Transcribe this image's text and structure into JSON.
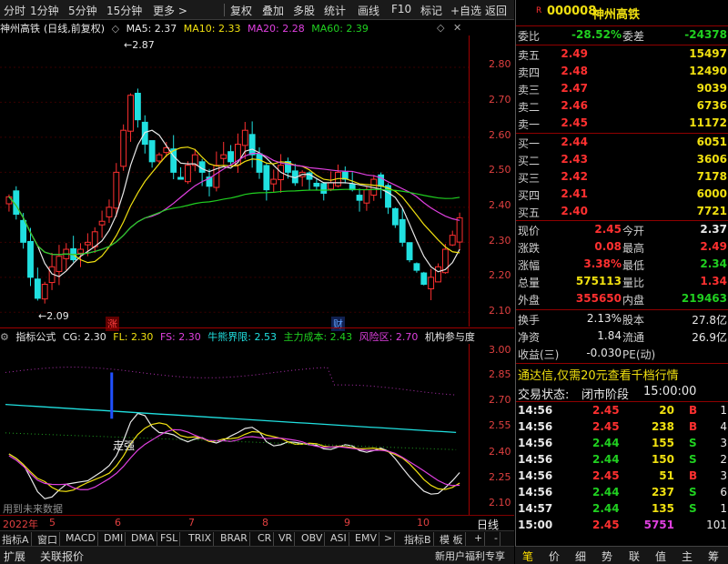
{
  "toolbar": {
    "items": [
      "分时",
      "1分钟",
      "5分钟",
      "15分钟",
      "更多 >",
      "复权",
      "叠加",
      "多股",
      "统计",
      "画线",
      "F10",
      "标记",
      "+自选",
      "返回"
    ]
  },
  "kline": {
    "name": "神州高铁",
    "mode": "(日线,前复权)",
    "ma": [
      {
        "label": "MA5: 2.37",
        "color": "#e8e8e8"
      },
      {
        "label": "MA10: 2.33",
        "color": "#f0e010"
      },
      {
        "label": "MA20: 2.28",
        "color": "#e040e0"
      },
      {
        "label": "MA60: 2.39",
        "color": "#20d020"
      }
    ],
    "y_ticks": [
      "2.80",
      "2.70",
      "2.60",
      "2.50",
      "2.40",
      "2.30",
      "2.20",
      "2.10"
    ],
    "high_mark": "2.87",
    "low_mark": "2.09",
    "tag_zhang": "涨",
    "tag_cai": "财",
    "closes": [
      2.43,
      2.38,
      2.3,
      2.2,
      2.14,
      2.18,
      2.23,
      2.26,
      2.28,
      2.25,
      2.28,
      2.3,
      2.33,
      2.36,
      2.4,
      2.5,
      2.62,
      2.72,
      2.65,
      2.58,
      2.53,
      2.55,
      2.57,
      2.5,
      2.48,
      2.52,
      2.55,
      2.5,
      2.46,
      2.52,
      2.55,
      2.53,
      2.58,
      2.62,
      2.55,
      2.5,
      2.45,
      2.48,
      2.52,
      2.5,
      2.47,
      2.5,
      2.48,
      2.46,
      2.44,
      2.47,
      2.5,
      2.48,
      2.45,
      2.42,
      2.45,
      2.48,
      2.46,
      2.4,
      2.35,
      2.3,
      2.25,
      2.22,
      2.18,
      2.2,
      2.23,
      2.28,
      2.32,
      2.37
    ]
  },
  "indicator": {
    "name": "指标公式",
    "items": [
      {
        "label": "CG: 2.30",
        "color": "#e8e8e8"
      },
      {
        "label": "FL: 2.30",
        "color": "#f0e010"
      },
      {
        "label": "FS: 2.30",
        "color": "#e040e0"
      },
      {
        "label": "牛熊界限: 2.53",
        "color": "#20e0e0"
      },
      {
        "label": "主力成本: 2.43",
        "color": "#20d020"
      },
      {
        "label": "风险区: 2.70",
        "color": "#e040e0"
      },
      {
        "label": "机构参与度",
        "color": "#e8e8e8"
      }
    ],
    "y_ticks": [
      "3.00",
      "2.85",
      "2.70",
      "2.55",
      "2.40",
      "2.25",
      "2.10"
    ],
    "label_zouqiang": "走强",
    "footer": "用到未来数据"
  },
  "dates": {
    "items": [
      "2022年",
      "5",
      "6",
      "7",
      "8",
      "9",
      "10"
    ],
    "period": "日线"
  },
  "tabs": [
    "指标A",
    "窗口",
    "MACD",
    "DMI",
    "DMA",
    "FSL",
    "TRIX",
    "BRAR",
    "CR",
    "VR",
    "OBV",
    "ASI",
    "EMV",
    ">",
    "指标B",
    "模 板",
    "+",
    "-"
  ],
  "bottom": [
    "扩展",
    "关联报价",
    "新用户福利专享"
  ],
  "quote": {
    "code": "000008",
    "name": "神州高铁",
    "flag": "R",
    "wb_label": "委比",
    "wb_value": "-28.52%",
    "wc_label": "委差",
    "wc_value": "-24378",
    "asks": [
      {
        "label": "卖五",
        "price": "2.49",
        "vol": "15497"
      },
      {
        "label": "卖四",
        "price": "2.48",
        "vol": "12490"
      },
      {
        "label": "卖三",
        "price": "2.47",
        "vol": "9039"
      },
      {
        "label": "卖二",
        "price": "2.46",
        "vol": "6736"
      },
      {
        "label": "卖一",
        "price": "2.45",
        "vol": "11172"
      }
    ],
    "bids": [
      {
        "label": "买一",
        "price": "2.44",
        "vol": "6051"
      },
      {
        "label": "买二",
        "price": "2.43",
        "vol": "3606"
      },
      {
        "label": "买三",
        "price": "2.42",
        "vol": "7178"
      },
      {
        "label": "买四",
        "price": "2.41",
        "vol": "6000"
      },
      {
        "label": "买五",
        "price": "2.40",
        "vol": "7721"
      }
    ],
    "stats": [
      {
        "l1": "现价",
        "v1": "2.45",
        "c1": "red",
        "l2": "今开",
        "v2": "2.37",
        "c2": "wht"
      },
      {
        "l1": "涨跌",
        "v1": "0.08",
        "c1": "red",
        "l2": "最高",
        "v2": "2.49",
        "c2": "red"
      },
      {
        "l1": "涨幅",
        "v1": "3.38%",
        "c1": "red",
        "l2": "最低",
        "v2": "2.34",
        "c2": "grn"
      },
      {
        "l1": "总量",
        "v1": "575113",
        "c1": "yel",
        "l2": "量比",
        "v2": "1.34",
        "c2": "red"
      },
      {
        "l1": "外盘",
        "v1": "355650",
        "c1": "red",
        "l2": "内盘",
        "v2": "219463",
        "c2": "grn"
      }
    ],
    "stats2": [
      {
        "l1": "换手",
        "v1": "2.13%",
        "c1": "wht",
        "l2": "股本",
        "v2": "27.8亿",
        "c2": "wht"
      },
      {
        "l1": "净资",
        "v1": "1.84",
        "c1": "wht",
        "l2": "流通",
        "v2": "26.9亿",
        "c2": "wht"
      },
      {
        "l1": "收益(三)",
        "v1": "-0.030",
        "c1": "wht",
        "l2": "PE(动)",
        "v2": "",
        "c2": "wht"
      }
    ],
    "promo": "通达信,仅需20元查看千档行情",
    "status_label": "交易状态:",
    "status_value": "闭市阶段",
    "status_time": "15:00:00",
    "ticks": [
      {
        "time": "14:56",
        "price": "2.45",
        "vol": "20",
        "side": "B",
        "n": "1"
      },
      {
        "time": "14:56",
        "price": "2.45",
        "vol": "238",
        "side": "B",
        "n": "4"
      },
      {
        "time": "14:56",
        "price": "2.44",
        "vol": "155",
        "side": "S",
        "n": "3"
      },
      {
        "time": "14:56",
        "price": "2.44",
        "vol": "150",
        "side": "S",
        "n": "2"
      },
      {
        "time": "14:56",
        "price": "2.45",
        "vol": "51",
        "side": "B",
        "n": "3"
      },
      {
        "time": "14:56",
        "price": "2.44",
        "vol": "237",
        "side": "S",
        "n": "6"
      },
      {
        "time": "14:57",
        "price": "2.44",
        "vol": "135",
        "side": "S",
        "n": "1"
      },
      {
        "time": "15:00",
        "price": "2.45",
        "vol": "5751",
        "side": "",
        "n": "101"
      }
    ],
    "bottom_tabs": [
      "笔",
      "价",
      "细",
      "势",
      "联",
      "值",
      "主",
      "筹"
    ]
  }
}
